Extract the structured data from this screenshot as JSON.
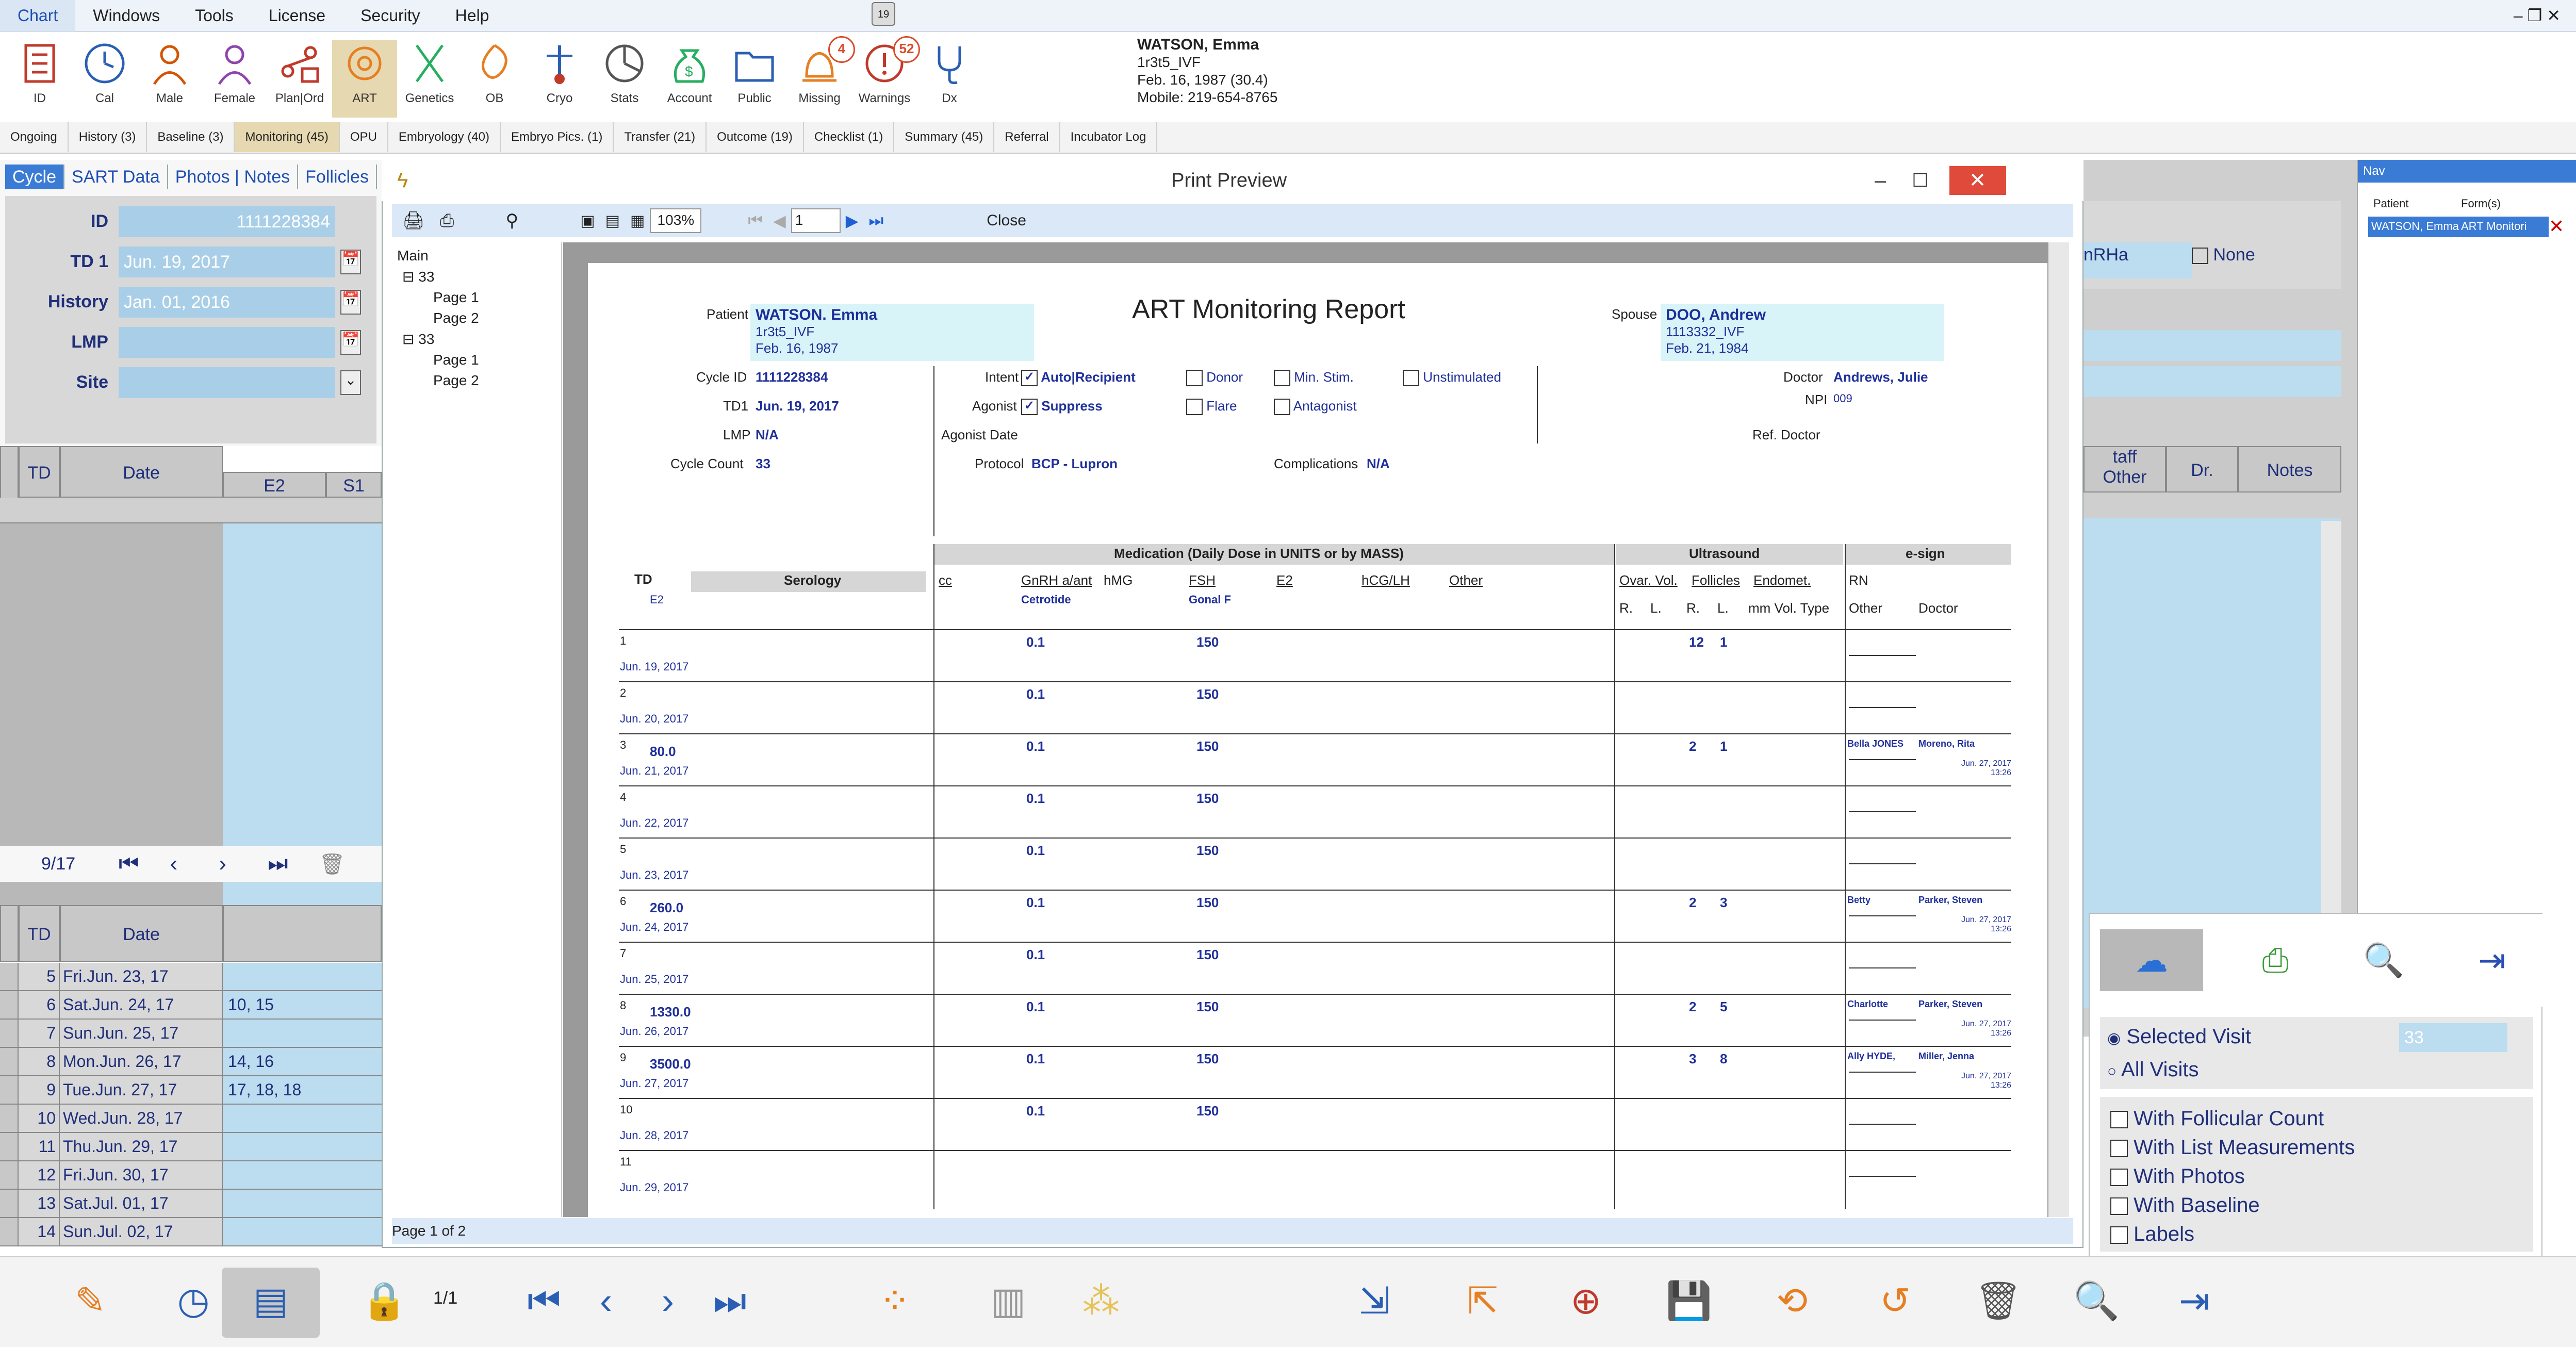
{
  "menu": {
    "items": [
      "Chart",
      "Windows",
      "Tools",
      "License",
      "Security",
      "Help"
    ],
    "active": "Chart"
  },
  "toolbar": {
    "buttons": [
      {
        "label": "ID",
        "icon": "id-card-icon"
      },
      {
        "label": "Cal",
        "icon": "clock-icon"
      },
      {
        "label": "Male",
        "icon": "male-icon"
      },
      {
        "label": "Female",
        "icon": "female-icon"
      },
      {
        "label": "Plan|Ord",
        "icon": "plan-icon"
      },
      {
        "label": "ART",
        "icon": "art-icon"
      },
      {
        "label": "Genetics",
        "icon": "dna-icon"
      },
      {
        "label": "OB",
        "icon": "ob-icon"
      },
      {
        "label": "Cryo",
        "icon": "cryo-icon"
      },
      {
        "label": "Stats",
        "icon": "pie-icon"
      },
      {
        "label": "Account",
        "icon": "money-bag-icon"
      },
      {
        "label": "Public",
        "icon": "folder-icon"
      },
      {
        "label": "Missing",
        "icon": "alarm-icon",
        "badge": "4"
      },
      {
        "label": "Warnings",
        "icon": "warning-icon",
        "badge": "52"
      },
      {
        "label": "Dx",
        "icon": "stethoscope-icon"
      }
    ],
    "active": "ART"
  },
  "patient": {
    "name": "WATSON, Emma",
    "code": "1r3t5_IVF",
    "dob": "Feb. 16, 1987 (30.4)",
    "mobile": "Mobile: 219-654-8765"
  },
  "tabs": [
    "Ongoing",
    "History (3)",
    "Baseline (3)",
    "Monitoring (45)",
    "OPU",
    "Embryology (40)",
    "Embryo Pics. (1)",
    "Transfer (21)",
    "Outcome (19)",
    "Checklist (1)",
    "Summary (45)",
    "Referral",
    "Incubator Log"
  ],
  "active_tab": "Monitoring (45)",
  "left": {
    "subtabs": [
      "Cycle",
      "SART Data",
      "Photos | Notes",
      "Follicles"
    ],
    "fields": [
      {
        "label": "ID",
        "value": "1111228384"
      },
      {
        "label": "TD 1",
        "value": "Jun. 19, 2017"
      },
      {
        "label": "History",
        "value": "Jan. 01, 2016"
      },
      {
        "label": "LMP",
        "value": ""
      },
      {
        "label": "Site",
        "value": ""
      }
    ],
    "grid1_headers": [
      "TD",
      "Date",
      "E2",
      "S1"
    ],
    "nav_count": "9/17",
    "grid2_headers": [
      "TD",
      "Date"
    ],
    "rows": [
      {
        "td": "5",
        "date": "Fri.Jun. 23, 17",
        "val": ""
      },
      {
        "td": "6",
        "date": "Sat.Jun. 24, 17",
        "val": "10, 15"
      },
      {
        "td": "7",
        "date": "Sun.Jun. 25, 17",
        "val": ""
      },
      {
        "td": "8",
        "date": "Mon.Jun. 26, 17",
        "val": "14, 16"
      },
      {
        "td": "9",
        "date": "Tue.Jun. 27, 17",
        "val": "17, 18, 18"
      },
      {
        "td": "10",
        "date": "Wed.Jun. 28, 17",
        "val": ""
      },
      {
        "td": "11",
        "date": "Thu.Jun. 29, 17",
        "val": ""
      },
      {
        "td": "12",
        "date": "Fri.Jun. 30, 17",
        "val": ""
      },
      {
        "td": "13",
        "date": "Sat.Jul. 01, 17",
        "val": ""
      },
      {
        "td": "14",
        "date": "Sun.Jul. 02, 17",
        "val": ""
      }
    ]
  },
  "preview": {
    "title": "Print Preview",
    "zoom": "103%",
    "page_input": "1",
    "close": "Close",
    "status": "Page 1 of 2",
    "tree": {
      "root": "Main",
      "nodes": [
        {
          "name": "33",
          "pages": [
            "Page 1",
            "Page 2"
          ]
        },
        {
          "name": "33",
          "pages": [
            "Page 1",
            "Page 2"
          ]
        }
      ]
    }
  },
  "report": {
    "title": "ART Monitoring Report",
    "patient_label": "Patient",
    "patient_name": "WATSON. Emma",
    "patient_code": "1r3t5_IVF",
    "patient_dob": "Feb. 16, 1987",
    "spouse_label": "Spouse",
    "spouse_name": "DOO, Andrew",
    "spouse_code": "1113332_IVF",
    "spouse_dob": "Feb. 21, 1984",
    "cycle_id_label": "Cycle ID",
    "cycle_id": "1111228384",
    "td1_label": "TD1",
    "td1": "Jun. 19, 2017",
    "lmp_label": "LMP",
    "lmp": "N/A",
    "cycle_count_label": "Cycle Count",
    "cycle_count": "33",
    "intent_label": "Intent",
    "intent_value": "Auto|Recipient",
    "donor": "Donor",
    "min_stim": "Min. Stim.",
    "unstimulated": "Unstimulated",
    "agonist_label": "Agonist",
    "agonist_value": "Suppress",
    "flare": "Flare",
    "antagonist": "Antagonist",
    "agonist_date_label": "Agonist Date",
    "protocol_label": "Protocol",
    "protocol": "BCP - Lupron",
    "complications_label": "Complications",
    "complications": "N/A",
    "doctor_label": "Doctor",
    "doctor": "Andrews, Julie",
    "npi_label": "NPI",
    "npi": "009",
    "ref_doctor_label": "Ref. Doctor",
    "med_header": "Medication (Daily Dose in UNITS or by MASS)",
    "us_header": "Ultrasound",
    "esign_header": "e-sign",
    "col_td": "TD",
    "col_serology": "Serology",
    "col_e2": "E2",
    "col_cc": "cc",
    "col_gnrh": "GnRH a/ant",
    "col_hmg": "hMG",
    "col_fsh": "FSH",
    "col_e2m": "E2",
    "col_hcg": "hCG/LH",
    "col_other": "Other",
    "col_cetrotide": "Cetrotide",
    "col_gonal": "Gonal F",
    "col_ovar": "Ovar. Vol.",
    "col_foll": "Follicles",
    "col_endo": "Endomet.",
    "col_r": "R.",
    "col_l": "L.",
    "col_mm": "mm Vol. Type",
    "col_rn": "RN",
    "col_esother": "Other",
    "col_esdoctor": "Doctor",
    "rows": [
      {
        "td": "1",
        "date": "Jun. 19, 2017",
        "e2": "",
        "gnrh": "0.1",
        "fsh": "150",
        "fr": "12",
        "fl": "1",
        "nurse": "",
        "doc": "",
        "sig": ""
      },
      {
        "td": "2",
        "date": "Jun. 20, 2017",
        "e2": "",
        "gnrh": "0.1",
        "fsh": "150",
        "fr": "",
        "fl": "",
        "nurse": "",
        "doc": "",
        "sig": ""
      },
      {
        "td": "3",
        "date": "Jun. 21, 2017",
        "e2": "80.0",
        "gnrh": "0.1",
        "fsh": "150",
        "fr": "2",
        "fl": "1",
        "nurse": "Bella JONES",
        "doc": "Moreno, Rita",
        "sig": "Jun. 27, 2017 13:26"
      },
      {
        "td": "4",
        "date": "Jun. 22, 2017",
        "e2": "",
        "gnrh": "0.1",
        "fsh": "150",
        "fr": "",
        "fl": "",
        "nurse": "",
        "doc": "",
        "sig": ""
      },
      {
        "td": "5",
        "date": "Jun. 23, 2017",
        "e2": "",
        "gnrh": "0.1",
        "fsh": "150",
        "fr": "",
        "fl": "",
        "nurse": "",
        "doc": "",
        "sig": ""
      },
      {
        "td": "6",
        "date": "Jun. 24, 2017",
        "e2": "260.0",
        "gnrh": "0.1",
        "fsh": "150",
        "fr": "2",
        "fl": "3",
        "nurse": "Betty",
        "doc": "Parker, Steven",
        "sig": "Jun. 27, 2017 13:26"
      },
      {
        "td": "7",
        "date": "Jun. 25, 2017",
        "e2": "",
        "gnrh": "0.1",
        "fsh": "150",
        "fr": "",
        "fl": "",
        "nurse": "",
        "doc": "",
        "sig": ""
      },
      {
        "td": "8",
        "date": "Jun. 26, 2017",
        "e2": "1330.0",
        "gnrh": "0.1",
        "fsh": "150",
        "fr": "2",
        "fl": "5",
        "nurse": "Charlotte",
        "doc": "Parker, Steven",
        "sig": "Jun. 27, 2017 13:26"
      },
      {
        "td": "9",
        "date": "Jun. 27, 2017",
        "e2": "3500.0",
        "gnrh": "0.1",
        "fsh": "150",
        "fr": "3",
        "fl": "8",
        "nurse": "Ally HYDE,",
        "doc": "Miller, Jenna",
        "sig": "Jun. 27, 2017 13:26"
      },
      {
        "td": "10",
        "date": "Jun. 28, 2017",
        "e2": "",
        "gnrh": "0.1",
        "fsh": "150",
        "fr": "",
        "fl": "",
        "nurse": "",
        "doc": "",
        "sig": ""
      },
      {
        "td": "11",
        "date": "Jun. 29, 2017",
        "e2": "",
        "gnrh": "",
        "fsh": "",
        "fr": "",
        "fl": "",
        "nurse": "",
        "doc": "",
        "sig": ""
      }
    ]
  },
  "right": {
    "gnrha": "nRHa",
    "none": "None",
    "headers": [
      "taff",
      "Other",
      "Dr.",
      "Notes"
    ]
  },
  "nav_panel": {
    "title": "Nav",
    "col_patient": "Patient",
    "col_form": "Form(s)",
    "patient": "WATSON, Emma",
    "form": "ART Monitori"
  },
  "export": {
    "selected_visit": "Selected Visit",
    "visit_value": "33",
    "all_visits": "All Visits",
    "options": [
      "With Follicular Count",
      "With List Measurements",
      "With Photos",
      "With Baseline",
      "Labels"
    ]
  },
  "bottom": {
    "page_count": "1/1"
  },
  "colors": {
    "accent": "#1f2f9a",
    "field_blue": "#a9cfe8",
    "active_tab": "#e6d8b0"
  }
}
